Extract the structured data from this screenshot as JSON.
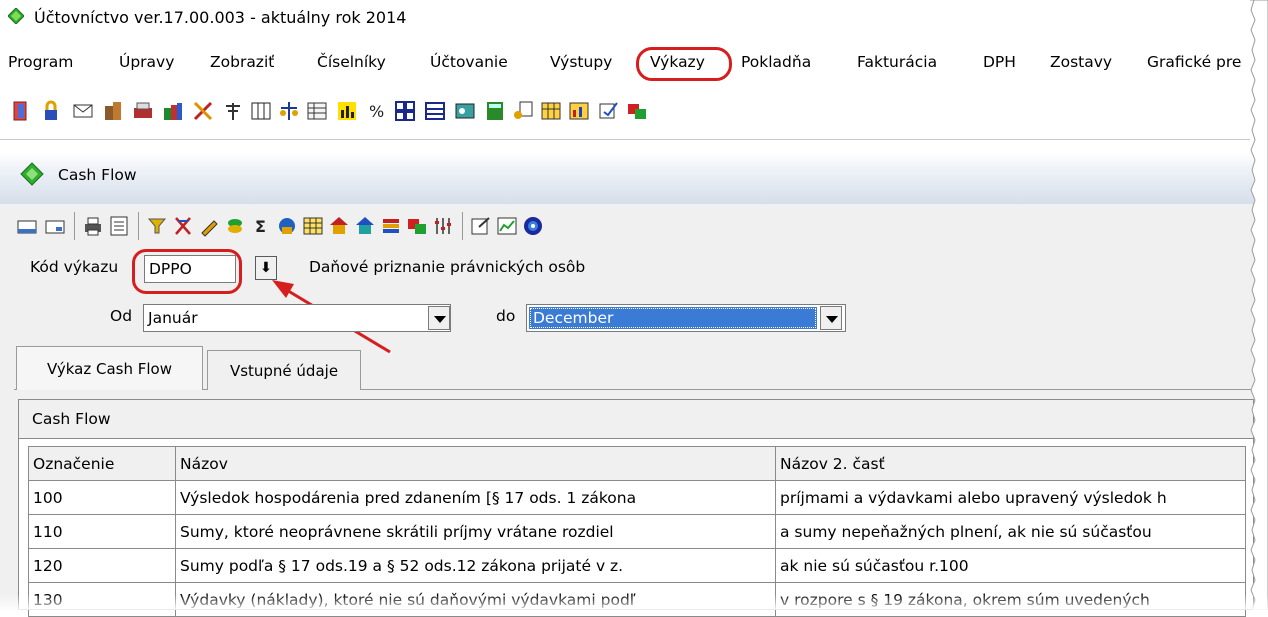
{
  "window": {
    "title": "Účtovníctvo ver.17.00.003  - aktuálny rok 2014"
  },
  "menu": {
    "items": [
      "Program",
      "Úpravy",
      "Zobraziť",
      "Číselníky",
      "Účtovanie",
      "Výstupy",
      "Výkazy",
      "Pokladňa",
      "Fakturácia",
      "DPH",
      "Zostavy",
      "Grafické pre"
    ],
    "highlighted": "Výkazy"
  },
  "child_window": {
    "title": "Cash Flow"
  },
  "form": {
    "kod_label": "Kód výkazu",
    "kod_value": "DPPO",
    "kod_description": "Daňové priznanie právnických osôb",
    "od_label": "Od",
    "od_value": "Január",
    "do_label": "do",
    "do_value": "December"
  },
  "tabs": [
    {
      "label": "Výkaz Cash Flow",
      "active": true
    },
    {
      "label": "Vstupné údaje",
      "active": false
    }
  ],
  "grid": {
    "caption": "Cash Flow",
    "columns": [
      "Označenie",
      "Názov",
      "Názov 2. časť"
    ],
    "rows": [
      [
        "100",
        "Výsledok hospodárenia pred zdanením [§ 17 ods. 1 zákona",
        "príjmami a výdavkami alebo upravený výsledok h"
      ],
      [
        "110",
        "Sumy, ktoré neoprávnene skrátili príjmy vrátane rozdiel",
        "a sumy nepeňažných plnení, ak nie sú súčasťou"
      ],
      [
        "120",
        "Sumy podľa § 17 ods.19 a § 52 ods.12 zákona prijaté v z.",
        "ak nie sú súčasťou r.100"
      ],
      [
        "130",
        "Výdavky (náklady), ktoré nie sú daňovými výdavkami podľ",
        "v rozpore s § 19 zákona, okrem súm uvedených"
      ]
    ]
  },
  "colors": {
    "highlight_red": "#d61e1e",
    "selection_blue": "#3a7bd5"
  }
}
